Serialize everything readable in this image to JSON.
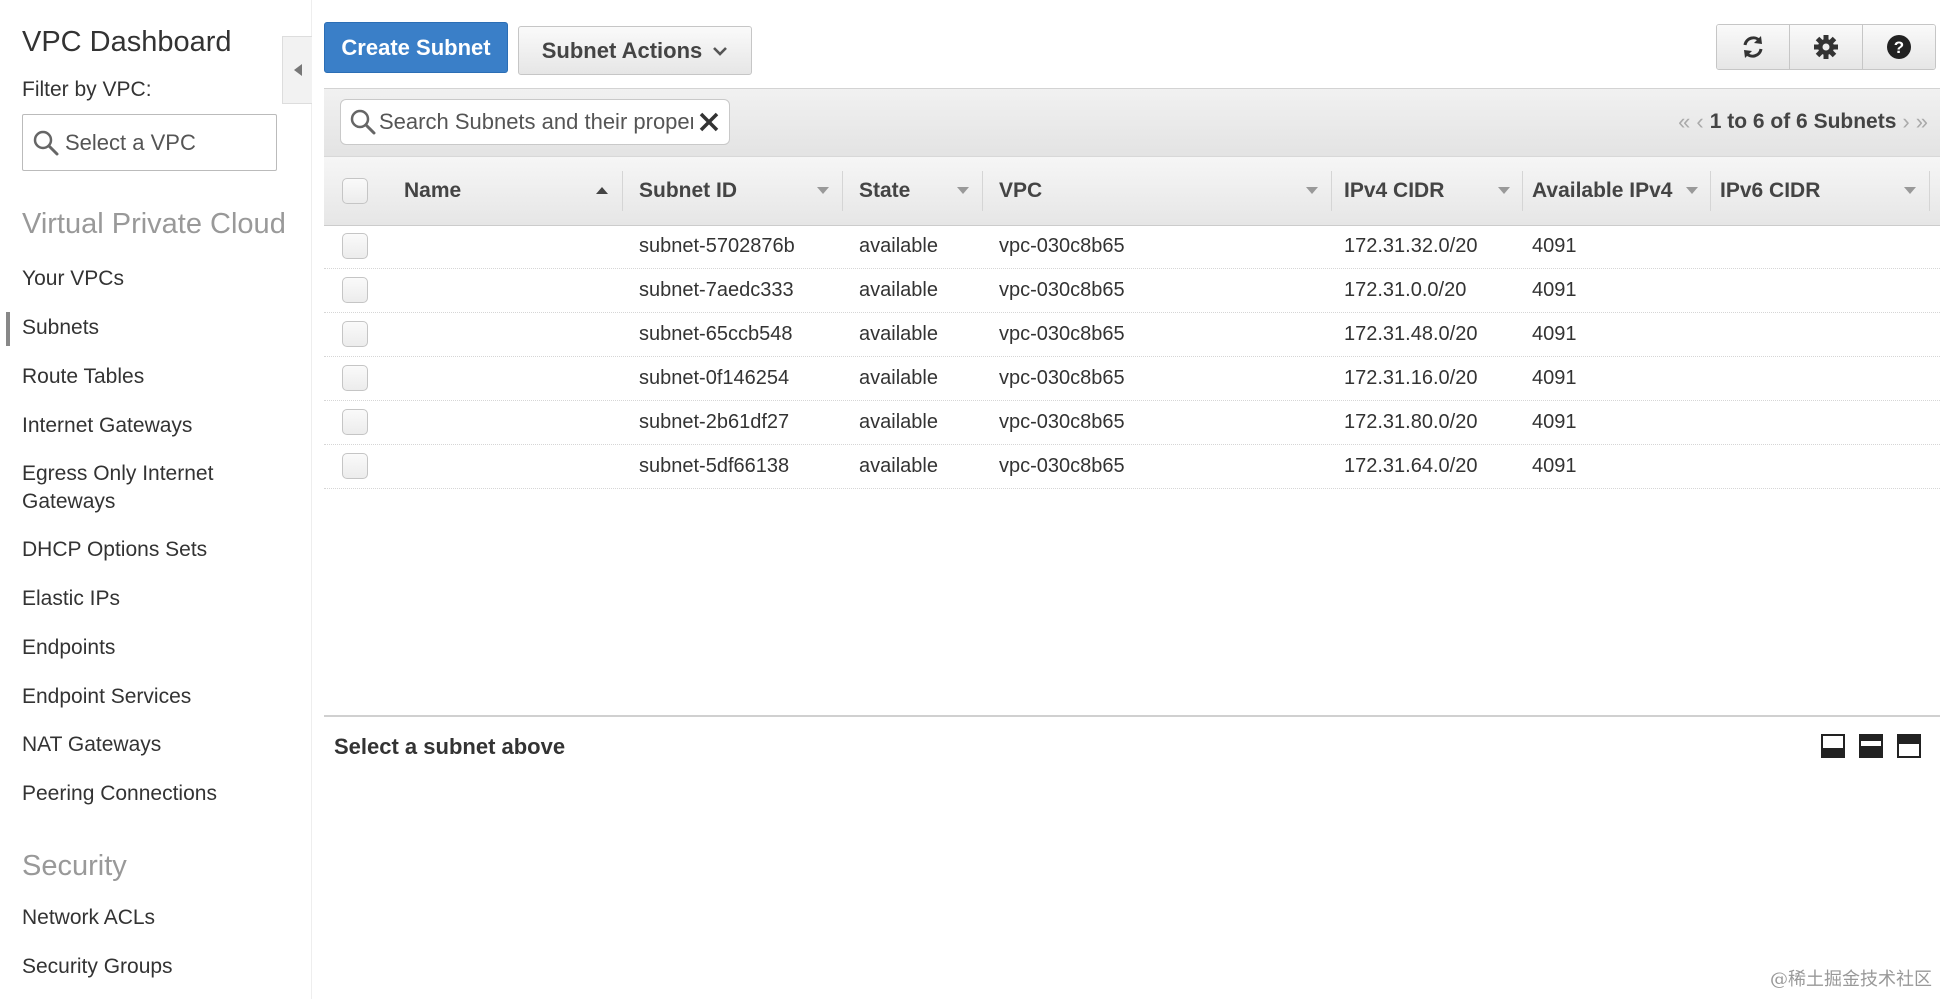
{
  "sidebar": {
    "title": "VPC Dashboard",
    "filter_label": "Filter by VPC:",
    "vpc_select_placeholder": "Select a VPC",
    "section_vpc": "Virtual Private Cloud",
    "vpc_items": [
      "Your VPCs",
      "Subnets",
      "Route Tables",
      "Internet Gateways",
      "Egress Only Internet Gateways",
      "DHCP Options Sets",
      "Elastic IPs",
      "Endpoints",
      "Endpoint Services",
      "NAT Gateways",
      "Peering Connections"
    ],
    "active_item": "Subnets",
    "section_security": "Security",
    "security_items": [
      "Network ACLs",
      "Security Groups"
    ]
  },
  "toolbar": {
    "create_label": "Create Subnet",
    "actions_label": "Subnet Actions",
    "icons": [
      "refresh-icon",
      "gear-icon",
      "help-icon"
    ]
  },
  "filter": {
    "search_placeholder": "Search Subnets and their properties",
    "pager_text": "1 to 6 of 6 Subnets"
  },
  "table": {
    "columns": [
      "Name",
      "Subnet ID",
      "State",
      "VPC",
      "IPv4 CIDR",
      "Available IPv4",
      "IPv6 CIDR"
    ],
    "rows": [
      {
        "name": "",
        "subnet_id": "subnet-5702876b",
        "state": "available",
        "vpc": "vpc-030c8b65",
        "ipv4_cidr": "172.31.32.0/20",
        "available_ipv4": "4091",
        "ipv6_cidr": ""
      },
      {
        "name": "",
        "subnet_id": "subnet-7aedc333",
        "state": "available",
        "vpc": "vpc-030c8b65",
        "ipv4_cidr": "172.31.0.0/20",
        "available_ipv4": "4091",
        "ipv6_cidr": ""
      },
      {
        "name": "",
        "subnet_id": "subnet-65ccb548",
        "state": "available",
        "vpc": "vpc-030c8b65",
        "ipv4_cidr": "172.31.48.0/20",
        "available_ipv4": "4091",
        "ipv6_cidr": ""
      },
      {
        "name": "",
        "subnet_id": "subnet-0f146254",
        "state": "available",
        "vpc": "vpc-030c8b65",
        "ipv4_cidr": "172.31.16.0/20",
        "available_ipv4": "4091",
        "ipv6_cidr": ""
      },
      {
        "name": "",
        "subnet_id": "subnet-2b61df27",
        "state": "available",
        "vpc": "vpc-030c8b65",
        "ipv4_cidr": "172.31.80.0/20",
        "available_ipv4": "4091",
        "ipv6_cidr": ""
      },
      {
        "name": "",
        "subnet_id": "subnet-5df66138",
        "state": "available",
        "vpc": "vpc-030c8b65",
        "ipv4_cidr": "172.31.64.0/20",
        "available_ipv4": "4091",
        "ipv6_cidr": ""
      }
    ]
  },
  "details": {
    "empty_label": "Select a subnet above"
  },
  "watermark": "@稀土掘金技术社区",
  "colors": {
    "primary_button": "#3a7fc8",
    "section_heading": "#999999"
  }
}
